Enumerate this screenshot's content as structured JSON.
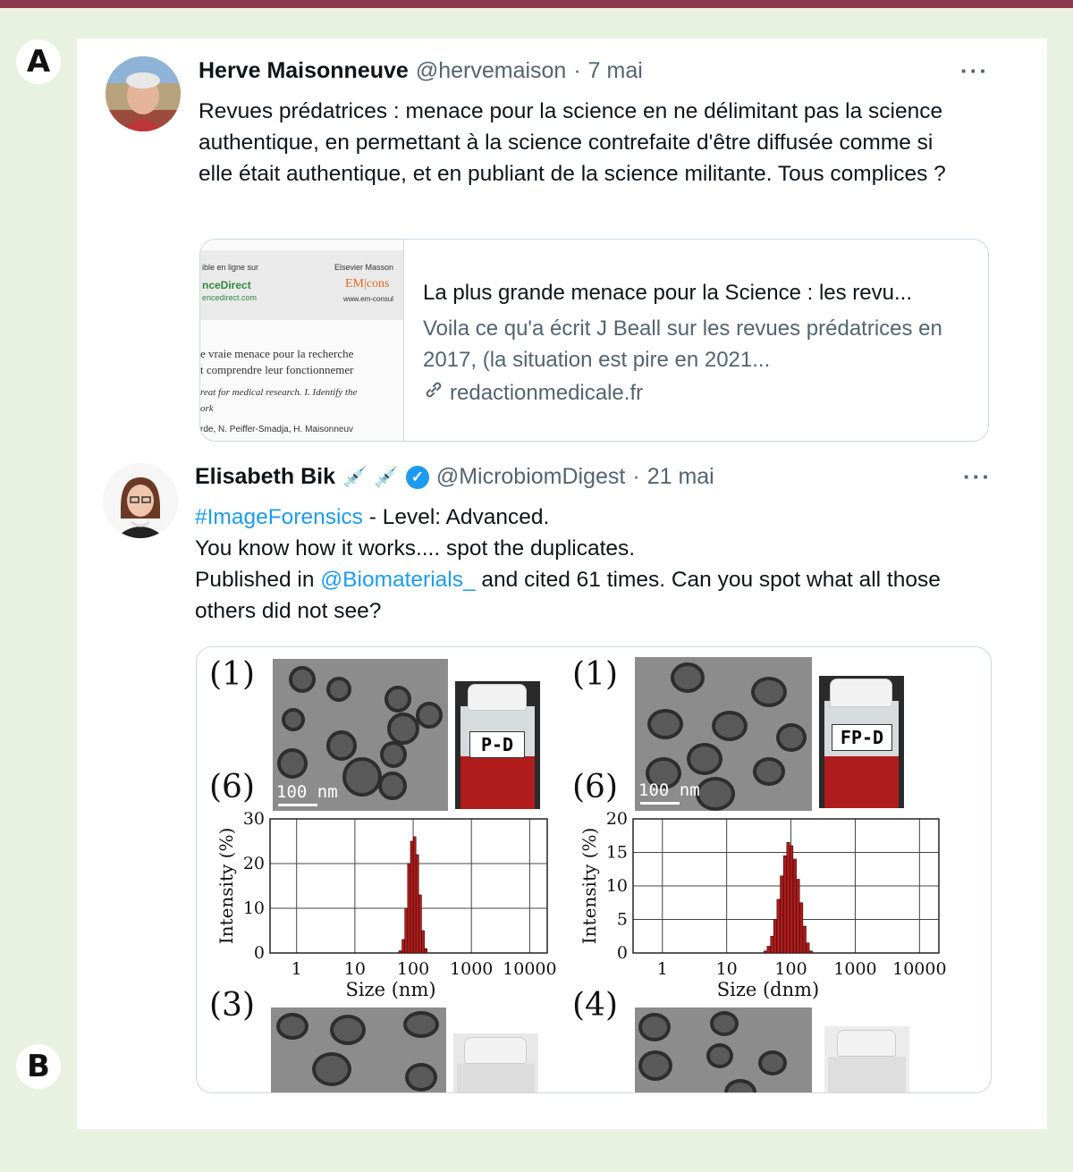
{
  "panels": {
    "a": "A",
    "b": "B"
  },
  "tweet1": {
    "author": "Herve Maisonneuve",
    "handle": "@hervemaison",
    "sep": "·",
    "date": "7 mai",
    "more": "···",
    "text": "Revues prédatrices : menace pour la science en ne délimitant pas la science authentique, en permettant à la science contrefaite d'être diffusée comme si elle était authentique, et en publiant de la science militante. Tous complices ?",
    "link_card": {
      "title": "La plus grande menace pour la Science : les revu...",
      "description": "Voila ce qu'a écrit J Beall sur les revues prédatrices en 2017, (la situation est pire en 2021...",
      "domain": "redactionmedicale.fr",
      "thumb": {
        "line1": "ible en ligne sur",
        "line2": "Elsevier Masson",
        "brand1": "nceDirect",
        "brand2": "encedirect.com",
        "brand3": "EM|cons",
        "brand4": "www.em-consul",
        "title1": "e vraie menace pour la recherche",
        "title2": "t comprendre leur fonctionnemer",
        "en1": "reat for medical research. I. Identify the",
        "en2": "ork",
        "authors": "rde, N. Peiffer-Smadja, H. Maisonneuv"
      }
    }
  },
  "tweet2": {
    "author": "Elisabeth Bik",
    "handle": "@MicrobiomDigest",
    "sep": "·",
    "date": "21 mai",
    "more": "···",
    "verified": "✓",
    "syringe": "💉",
    "hashtag": "#ImageForensics",
    "line1_rest": " - Level: Advanced.",
    "line2": "You know how it works.... spot the duplicates.",
    "line3_pre": "Published in ",
    "mention": "@Biomaterials_",
    "line3_post": " and cited 61 times. Can you spot what all those others did not see?"
  },
  "figure": {
    "left": {
      "label_top": "(1)",
      "label_mid": "(6)",
      "label_bottom": "(3)",
      "scale": "100 nm",
      "vial_label": "P-D"
    },
    "right": {
      "label_top": "(1)",
      "label_mid": "(6)",
      "label_bottom": "(4)",
      "scale": "100 nm",
      "vial_label": "FP-D"
    }
  },
  "chart_data": [
    {
      "type": "bar",
      "xlabel": "Size (nm)",
      "ylabel": "Intensity (%)",
      "x_scale": "log",
      "x_ticks": [
        "1",
        "10",
        "100",
        "1000",
        "10000"
      ],
      "y_ticks": [
        "0",
        "10",
        "20",
        "30"
      ],
      "ylim": [
        0,
        30
      ],
      "grid": true,
      "x": [
        60,
        68,
        76,
        85,
        95,
        106,
        118,
        132,
        148,
        165
      ],
      "values": [
        0.5,
        3,
        10,
        20,
        25,
        26,
        22,
        13,
        5,
        1
      ],
      "color": "#b01c1c"
    },
    {
      "type": "bar",
      "xlabel": "Size (dnm)",
      "ylabel": "Intensity (%)",
      "x_scale": "log",
      "x_ticks": [
        "1",
        "10",
        "100",
        "1000",
        "10000"
      ],
      "y_ticks": [
        "0",
        "5",
        "10",
        "15",
        "20"
      ],
      "ylim": [
        0,
        20
      ],
      "grid": true,
      "x": [
        40,
        45,
        51,
        57,
        64,
        72,
        81,
        91,
        102,
        115,
        129,
        145,
        163,
        183,
        206
      ],
      "values": [
        0.3,
        1,
        2.5,
        5,
        8,
        11.5,
        14.5,
        16.5,
        16,
        14,
        11,
        7.5,
        4,
        1.5,
        0.3
      ],
      "color": "#b01c1c"
    }
  ]
}
